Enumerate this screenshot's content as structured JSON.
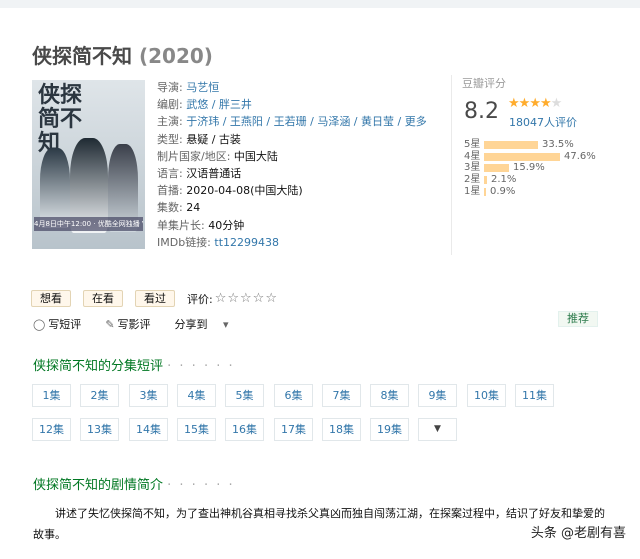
{
  "title": {
    "name": "侠探简不知",
    "year": "(2020)"
  },
  "poster": {
    "ink_title": "侠探简不知",
    "caption": "4月8日中午12:00 · 优酷全网独播 VIP会员抢先看"
  },
  "info": {
    "director": {
      "label": "导演:",
      "value": "马艺恒"
    },
    "writer": {
      "label": "编剧:",
      "value": "武悠 / 胖三井"
    },
    "cast": {
      "label": "主演:",
      "value": "于济玮 / 王燕阳 / 王若珊 / 马泽涵 / 黄日莹 / 更多..."
    },
    "genre": {
      "label": "类型:",
      "value": "悬疑 / 古装"
    },
    "country": {
      "label": "制片国家/地区:",
      "value": "中国大陆"
    },
    "language": {
      "label": "语言:",
      "value": "汉语普通话"
    },
    "premiere": {
      "label": "首播:",
      "value": "2020-04-08(中国大陆)"
    },
    "episodes": {
      "label": "集数:",
      "value": "24"
    },
    "runtime": {
      "label": "单集片长:",
      "value": "40分钟"
    },
    "imdb": {
      "label": "IMDb链接:",
      "value": "tt12299438"
    }
  },
  "rating": {
    "label": "豆瓣评分",
    "score": "8.2",
    "stars_filled": 4,
    "count": "18047人评价",
    "breakdown": [
      {
        "label": "5星",
        "pct": "33.5%",
        "value": 33.5
      },
      {
        "label": "4星",
        "pct": "47.6%",
        "value": 47.6
      },
      {
        "label": "3星",
        "pct": "15.9%",
        "value": 15.9
      },
      {
        "label": "2星",
        "pct": "2.1%",
        "value": 2.1
      },
      {
        "label": "1星",
        "pct": "0.9%",
        "value": 0.9
      }
    ]
  },
  "actions": {
    "want": "想看",
    "watching": "在看",
    "watched": "看过",
    "rate_label": "评价:",
    "stars": "☆☆☆☆☆"
  },
  "subactions": {
    "short_review": "写短评",
    "review": "写影评",
    "share": "分享到",
    "share_arrow": "▾",
    "recommend": "推荐"
  },
  "episodes_section": {
    "title": "侠探简不知的分集短评",
    "dots": "· · · · · ·"
  },
  "episodes": [
    "1集",
    "2集",
    "3集",
    "4集",
    "5集",
    "6集",
    "7集",
    "8集",
    "9集",
    "10集",
    "11集",
    "12集",
    "13集",
    "14集",
    "15集",
    "16集",
    "17集",
    "18集",
    "19集"
  ],
  "episodes_more": "▼",
  "synopsis_section": {
    "title": "侠探简不知的剧情简介",
    "dots": "· · · · · ·"
  },
  "synopsis": "讲述了失忆侠探简不知，为了查出神机谷真相寻找杀父真凶而独自闯荡江湖，在探案过程中，结识了好友和挚爱的故事。",
  "watermark": "头条 @老剧有喜",
  "colors": {
    "link": "#3377aa",
    "section": "#007722",
    "star": "#ffac2d",
    "bar": "#ffd596"
  }
}
